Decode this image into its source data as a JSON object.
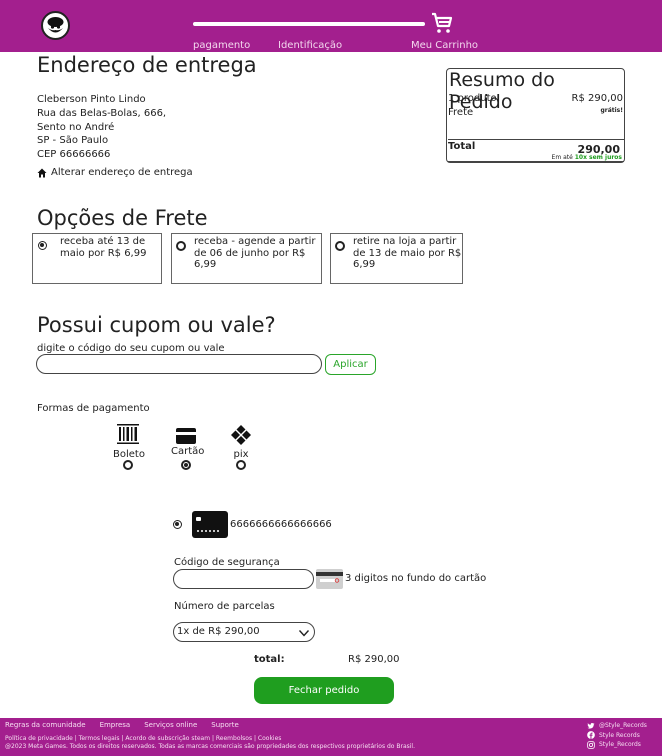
{
  "header": {
    "steps": [
      "pagamento",
      "Identificação",
      "Meu Carrinho"
    ]
  },
  "address": {
    "title": "Endereço de entrega",
    "lines": [
      "Cleberson Pinto Lindo",
      "Rua das Belas-Bolas, 666,",
      "Sento no André",
      "SP - São Paulo",
      "CEP 66666666"
    ],
    "change_label": "Alterar endereço de entrega"
  },
  "summary": {
    "title": "Resumo do Pedido",
    "products_label": "1 produto",
    "products_value": "R$ 290,00",
    "shipping_label": "Frete",
    "shipping_value": "grátis!",
    "total_label": "Total",
    "total_value": "290,00",
    "installments_prefix": "Em até ",
    "installments_highlight": "10x sem juros"
  },
  "shipping": {
    "title": "Opções de Frete",
    "options": [
      {
        "text": "receba até 13 de maio por R$ 6,99",
        "selected": true
      },
      {
        "text": "receba - agende a partir de 06 de junho por R$ 6,99",
        "selected": false
      },
      {
        "text": "retire na loja a partir de 13 de maio por R$ 6,99",
        "selected": false
      }
    ]
  },
  "coupon": {
    "title": "Possui cupom ou vale?",
    "label": "digite o código do seu cupom ou vale",
    "value": "",
    "apply_label": "Aplicar"
  },
  "payment": {
    "label": "Formas de pagamento",
    "methods": [
      {
        "label": "Boleto",
        "icon": "barcode-icon",
        "selected": false
      },
      {
        "label": "Cartão",
        "icon": "credit-card-icon",
        "selected": true
      },
      {
        "label": "pix",
        "icon": "pix-icon",
        "selected": false
      }
    ],
    "card_number": "6666666666666666",
    "cvv_label": "Código de segurança",
    "cvv_value": "",
    "cvv_hint": "3 digitos no fundo do cartão",
    "installments_label": "Número de parcelas",
    "installments_value": "1x de R$ 290,00",
    "total_label": "total:",
    "total_value": "R$ 290,00",
    "submit_label": "Fechar pedido"
  },
  "footer": {
    "links": [
      "Regras da comunidade",
      "Empresa",
      "Serviços online",
      "Suporte"
    ],
    "legal_line1": "Política de privacidade | Termos legais | Acordo de subscrição steam | Reembolsos | Cookies",
    "legal_line2": "@2023 Meta Games. Todos os direitos reservados. Todas as marcas comerciais são propriedades dos respectivos proprietários do Brasil.",
    "social": [
      "@Style_Records",
      "Style Records",
      "Style_Records"
    ]
  },
  "colors": {
    "brand": "#a31f8e",
    "accent_green": "#1f9e1f"
  }
}
